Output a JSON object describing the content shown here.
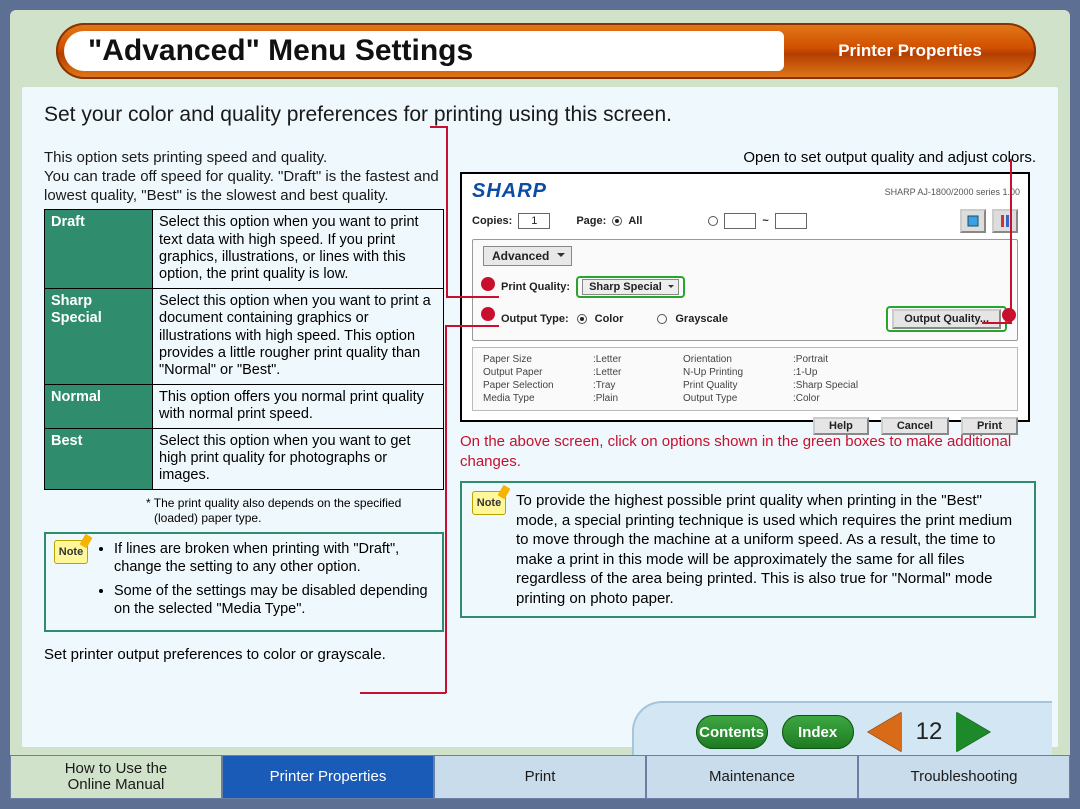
{
  "title": "\"Advanced\" Menu Settings",
  "title_right": "Printer Properties",
  "intro": "Set your color and quality preferences for printing using this screen.",
  "left": {
    "lead": "This option sets printing speed and quality.\nYou can trade off speed for quality. \"Draft\" is the fastest and lowest quality, \"Best\" is the slowest and best quality.",
    "rows": [
      {
        "name": "Draft",
        "desc": "Select this option when you want to print text data with high speed. If you print graphics, illustrations, or lines with this option, the print quality is low."
      },
      {
        "name": "Sharp Special",
        "desc": "Select this option when you want to print a document containing graphics or illustrations with high speed. This option provides a little rougher print quality than \"Normal\" or \"Best\"."
      },
      {
        "name": "Normal",
        "desc": "This option offers you normal print quality with normal print speed."
      },
      {
        "name": "Best",
        "desc": "Select this option when you want to get high print quality for photographs or images."
      }
    ],
    "footnote": "* The print quality also depends on the specified (loaded) paper type.",
    "note_label": "Note",
    "notes": [
      "If lines are broken when printing with \"Draft\", change the setting to any other option.",
      "Some of the settings may be disabled depending on the selected \"Media Type\"."
    ],
    "bottom_caption": "Set printer output preferences to color or grayscale."
  },
  "right": {
    "intro": "Open to set output quality and adjust colors.",
    "red_hint": "On the above screen, click on options shown in the green boxes to make additional changes.",
    "big_note_label": "Note",
    "big_note": "To provide the highest possible print quality when printing in the \"Best\" mode, a special printing technique is used which requires the print medium to move through the machine at a uniform speed. As a result, the time to make a print in this mode will be approximately the same for all files regardless of the area being printed. This is also true for \"Normal\" mode printing on photo paper."
  },
  "dialog": {
    "logo": "SHARP",
    "version": "SHARP AJ-1800/2000 series 1.00",
    "copies_label": "Copies:",
    "copies_value": "1",
    "page_label": "Page:",
    "page_all": "All",
    "tilde": "~",
    "tab": "Advanced",
    "pq_label": "Print Quality:",
    "pq_value": "Sharp Special",
    "ot_label": "Output Type:",
    "ot_color": "Color",
    "ot_gray": "Grayscale",
    "output_quality_btn": "Output Quality...",
    "props": [
      [
        "Paper Size",
        ":Letter",
        "Orientation",
        ":Portrait"
      ],
      [
        "Output Paper",
        ":Letter",
        "N-Up Printing",
        ":1-Up"
      ],
      [
        "Paper Selection",
        ":Tray",
        "Print Quality",
        ":Sharp Special"
      ],
      [
        "Media Type",
        ":Plain",
        "Output Type",
        ":Color"
      ]
    ],
    "help": "Help",
    "cancel": "Cancel",
    "print": "Print"
  },
  "nav": {
    "contents": "Contents",
    "index": "Index",
    "page": "12"
  },
  "tabs": {
    "howto": "How to Use the\nOnline Manual",
    "printer_props": "Printer Properties",
    "print": "Print",
    "maintenance": "Maintenance",
    "troubleshooting": "Troubleshooting"
  }
}
